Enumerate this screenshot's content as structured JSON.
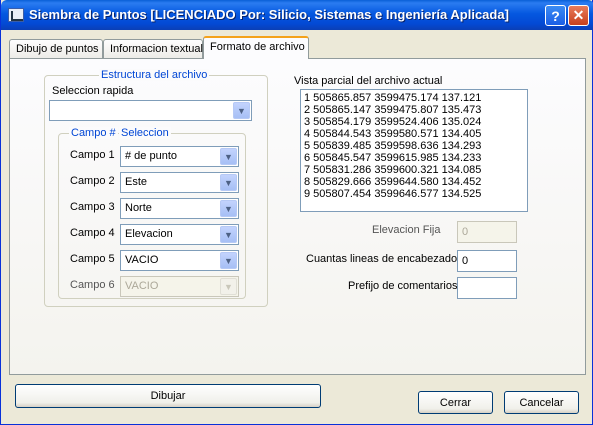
{
  "window": {
    "title": "Siembra de Puntos  [LICENCIADO Por: Silicio, Sistemas e Ingeniería Aplicada]",
    "help_glyph": "?",
    "close_glyph": "✕"
  },
  "tabs": [
    {
      "label": "Dibujo de puntos",
      "active": false
    },
    {
      "label": "Informacion textual",
      "active": false
    },
    {
      "label": "Formato de archivo",
      "active": true
    }
  ],
  "estructura": {
    "title": "Estructura del archivo",
    "seleccion_rapida_label": "Seleccion rapida",
    "seleccion_rapida_value": "",
    "campo_header": "Campo #",
    "seleccion_header": "Seleccion",
    "campos": [
      {
        "label": "Campo 1",
        "value": "# de punto",
        "enabled": true
      },
      {
        "label": "Campo 2",
        "value": "Este",
        "enabled": true
      },
      {
        "label": "Campo 3",
        "value": "Norte",
        "enabled": true
      },
      {
        "label": "Campo 4",
        "value": "Elevacion",
        "enabled": true
      },
      {
        "label": "Campo 5",
        "value": "VACIO",
        "enabled": true
      },
      {
        "label": "Campo 6",
        "value": "VACIO",
        "enabled": false
      }
    ]
  },
  "vista": {
    "label": "Vista parcial del archivo actual",
    "lines": [
      "1 505865.857 3599475.174 137.121",
      "2 505865.147 3599475.807 135.473",
      "3 505854.179 3599524.406 135.024",
      "4 505844.543 3599580.571 134.405",
      "5 505839.485 3599598.636 134.293",
      "6 505845.547 3599615.985 134.233",
      "7 505831.286 3599600.321 134.085",
      "8 505829.666 3599644.580 134.452",
      "9 505807.454 3599646.577 134.525"
    ]
  },
  "options": {
    "elevacion_fija_label": "Elevacion Fija",
    "elevacion_fija_value": "0",
    "encabezado_label": "Cuantas lineas de encabezado",
    "encabezado_value": "0",
    "prefijo_label": "Prefijo de comentarios",
    "prefijo_value": ""
  },
  "buttons": {
    "dibujar": "Dibujar",
    "cerrar": "Cerrar",
    "cancelar": "Cancelar"
  },
  "icons": {
    "dropdown_arrow": "▼"
  }
}
